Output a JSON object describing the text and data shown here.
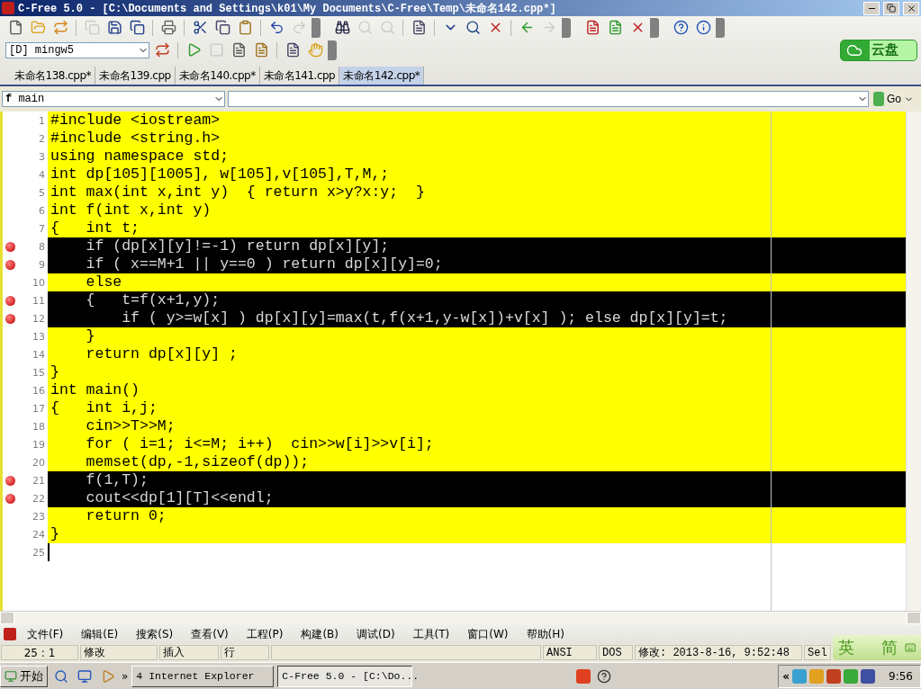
{
  "window": {
    "title": "C-Free 5.0 - [C:\\Documents and Settings\\k01\\My Documents\\C-Free\\Temp\\未命名142.cpp*]"
  },
  "compiler": {
    "value": "[D] mingw5"
  },
  "cloud_button": {
    "label": "云盘"
  },
  "tabs": [
    {
      "label": "未命名138.cpp*",
      "selected": false
    },
    {
      "label": "未命名139.cpp",
      "selected": false
    },
    {
      "label": "未命名140.cpp*",
      "selected": false
    },
    {
      "label": "未命名141.cpp",
      "selected": false
    },
    {
      "label": "未命名142.cpp*",
      "selected": true
    }
  ],
  "function_bar": {
    "symbol": "f",
    "function": "main",
    "go_label": "Go"
  },
  "editor": {
    "lines": [
      {
        "number": "1",
        "text": "#include <iostream>",
        "highlighted": true,
        "breakpoint": false
      },
      {
        "number": "2",
        "text": "#include <string.h>",
        "highlighted": true,
        "breakpoint": false
      },
      {
        "number": "3",
        "text": "using namespace std;",
        "highlighted": true,
        "breakpoint": false
      },
      {
        "number": "4",
        "text": "int dp[105][1005], w[105],v[105],T,M,;",
        "highlighted": true,
        "breakpoint": false
      },
      {
        "number": "5",
        "text": "int max(int x,int y)  { return x>y?x:y;  }",
        "highlighted": true,
        "breakpoint": false
      },
      {
        "number": "6",
        "text": "int f(int x,int y)",
        "highlighted": true,
        "breakpoint": false
      },
      {
        "number": "7",
        "text": "{   int t;",
        "highlighted": true,
        "breakpoint": false
      },
      {
        "number": "8",
        "text": "    if (dp[x][y]!=-1) return dp[x][y];",
        "highlighted": true,
        "breakpoint": true
      },
      {
        "number": "9",
        "text": "    if ( x==M+1 || y==0 ) return dp[x][y]=0;",
        "highlighted": true,
        "breakpoint": true
      },
      {
        "number": "10",
        "text": "    else",
        "highlighted": true,
        "breakpoint": false
      },
      {
        "number": "11",
        "text": "    {   t=f(x+1,y);",
        "highlighted": true,
        "breakpoint": true
      },
      {
        "number": "12",
        "text": "        if ( y>=w[x] ) dp[x][y]=max(t,f(x+1,y-w[x])+v[x] ); else dp[x][y]=t;",
        "highlighted": true,
        "breakpoint": true
      },
      {
        "number": "13",
        "text": "    }",
        "highlighted": true,
        "breakpoint": false
      },
      {
        "number": "14",
        "text": "    return dp[x][y] ;",
        "highlighted": true,
        "breakpoint": false
      },
      {
        "number": "15",
        "text": "}",
        "highlighted": true,
        "breakpoint": false
      },
      {
        "number": "16",
        "text": "int main()",
        "highlighted": true,
        "breakpoint": false
      },
      {
        "number": "17",
        "text": "{   int i,j;",
        "highlighted": true,
        "breakpoint": false
      },
      {
        "number": "18",
        "text": "    cin>>T>>M;",
        "highlighted": true,
        "breakpoint": false
      },
      {
        "number": "19",
        "text": "    for ( i=1; i<=M; i++)  cin>>w[i]>>v[i];",
        "highlighted": true,
        "breakpoint": false
      },
      {
        "number": "20",
        "text": "    memset(dp,-1,sizeof(dp));",
        "highlighted": true,
        "breakpoint": false
      },
      {
        "number": "21",
        "text": "    f(1,T);",
        "highlighted": true,
        "breakpoint": true
      },
      {
        "number": "22",
        "text": "    cout<<dp[1][T]<<endl;",
        "highlighted": true,
        "breakpoint": true
      },
      {
        "number": "23",
        "text": "    return 0;",
        "highlighted": true,
        "breakpoint": false
      },
      {
        "number": "24",
        "text": "}",
        "highlighted": true,
        "breakpoint": false
      },
      {
        "number": "25",
        "highlighted": false,
        "breakpoint": false
      }
    ]
  },
  "menu": [
    "文件(F)",
    "编辑(E)",
    "搜索(S)",
    "查看(V)",
    "工程(P)",
    "构建(B)",
    "调试(D)",
    "工具(T)",
    "窗口(W)",
    "帮助(H)"
  ],
  "status_bar": [
    "25 : 1",
    "修改",
    "插入",
    "行",
    "ANSI",
    "DOS",
    "修改: 2013-8-16, 9:52:48",
    "Sel"
  ],
  "ime": {
    "language": "英",
    "script": "简"
  },
  "taskbar": {
    "start": "开始",
    "expand": "»",
    "windows": [
      {
        "label": "4 Internet Explorer",
        "selected": false
      },
      {
        "label": "C-Free 5.0 - [C:\\Do...",
        "selected": true
      }
    ],
    "tray_expand": "«",
    "clock": "9:56"
  }
}
